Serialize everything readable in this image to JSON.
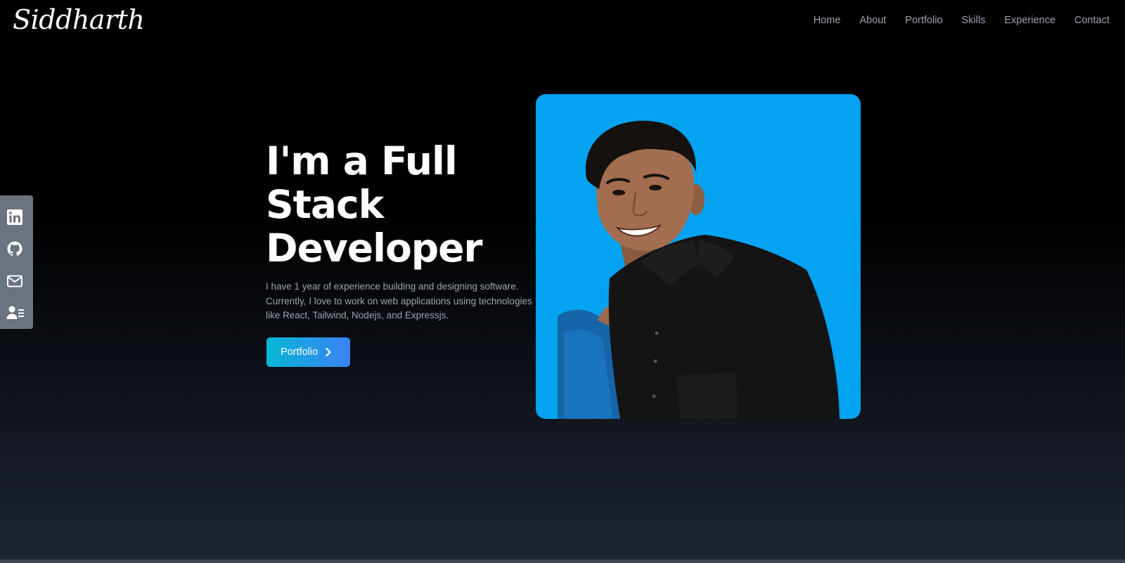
{
  "logo": {
    "text": "Siddharth"
  },
  "nav": {
    "links": [
      {
        "label": "Home"
      },
      {
        "label": "About"
      },
      {
        "label": "Portfolio"
      },
      {
        "label": "Skills"
      },
      {
        "label": "Experience"
      },
      {
        "label": "Contact"
      }
    ]
  },
  "social": {
    "items": [
      {
        "icon": "linkedin-icon"
      },
      {
        "icon": "github-icon"
      },
      {
        "icon": "mail-icon"
      },
      {
        "icon": "resume-icon"
      }
    ]
  },
  "hero": {
    "title_line1": "I'm a Full",
    "title_line2": "Stack",
    "title_line3": "Developer",
    "description": "I have 1 year of experience building and designing software. Currently, I love to work on web applications using technologies like React, Tailwind, Nodejs, and Expressjs.",
    "button_label": "Portfolio"
  },
  "colors": {
    "accent_start": "#06b6d4",
    "accent_end": "#3b82f6",
    "photo_background": "#03a3f2",
    "social_bar": "#6b7280",
    "nav_text": "#9ca3af"
  }
}
